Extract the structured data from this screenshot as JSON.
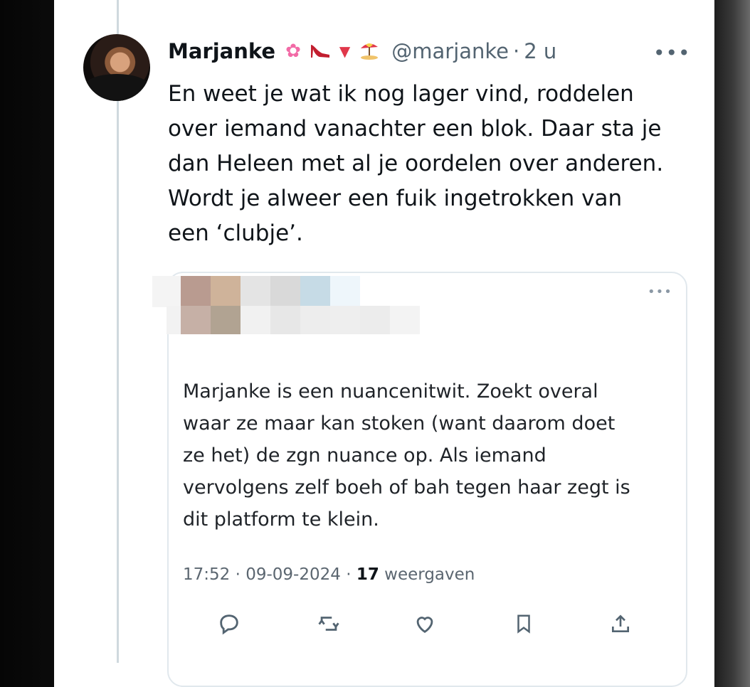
{
  "tweet": {
    "display_name": "Marjanke",
    "name_emojis": [
      "flower-emoji",
      "high-heel-emoji",
      "red-triangle-emoji",
      "beach-umbrella-emoji"
    ],
    "handle": "@marjanke",
    "separator": "·",
    "time": "2 u",
    "more_label": "•••",
    "text_lines": [
      "En weet je wat ik nog lager vind, roddelen",
      "over iemand vanachter een blok. Daar sta je",
      "dan Heleen met al je oordelen over anderen.",
      "Wordt je alweer een fuik ingetrokken van",
      "een ‘clubje’."
    ]
  },
  "quoted_tweet": {
    "more_label": "•••",
    "text_lines": [
      "Marjanke is een nuancenitwit. Zoekt overal",
      "waar ze maar kan stoken (want daarom doet",
      "ze het) de zgn nuance op. Als iemand",
      "vervolgens zelf boeh of bah tegen haar zegt is",
      "dit platform te klein."
    ],
    "timestamp": "17:52 · 09-09-2024 ·",
    "views_count": "17",
    "views_label": "weergaven",
    "actions": [
      "reply-icon",
      "retweet-icon",
      "like-icon",
      "bookmark-icon",
      "share-icon"
    ]
  },
  "colors": {
    "text": "#0f1419",
    "secondary": "#536471",
    "border": "#e1e8ed",
    "thread_line": "#cfd9de"
  }
}
